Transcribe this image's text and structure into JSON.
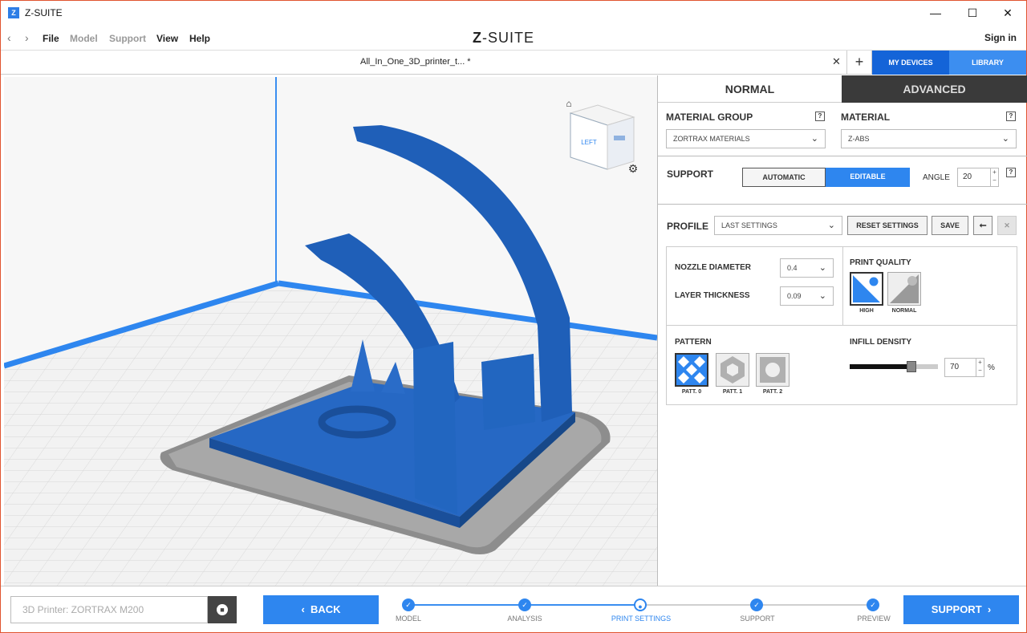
{
  "window": {
    "title": "Z-SUITE",
    "icon_letter": "Z",
    "minimize": "—",
    "maximize": "☐",
    "close": "✕"
  },
  "menu": {
    "back": "‹",
    "forward": "›",
    "items": [
      "File",
      "Model",
      "Support",
      "View",
      "Help"
    ],
    "logo_mark": "Z",
    "logo_text": "-SUITE",
    "signin": "Sign in"
  },
  "tabs": {
    "document": "All_In_One_3D_printer_t... *",
    "close": "✕",
    "add": "+",
    "devices": "MY DEVICES",
    "library": "LIBRARY"
  },
  "viewcube": {
    "face": "LEFT",
    "home_icon": "home-icon",
    "settings_icon": "gear-icon"
  },
  "panel": {
    "mode_normal": "NORMAL",
    "mode_advanced": "ADVANCED",
    "material_group_label": "MATERIAL GROUP",
    "material_group_value": "ZORTRAX MATERIALS",
    "material_label": "MATERIAL",
    "material_value": "Z-ABS",
    "help": "?",
    "support_label": "SUPPORT",
    "support_automatic": "AUTOMATIC",
    "support_editable": "EDITABLE",
    "angle_label": "ANGLE",
    "angle_value": "20",
    "profile_label": "PROFILE",
    "profile_value": "LAST SETTINGS",
    "reset_label": "RESET SETTINGS",
    "save_label": "SAVE",
    "nozzle_label": "NOZZLE DIAMETER",
    "nozzle_value": "0.4",
    "layer_label": "LAYER THICKNESS",
    "layer_value": "0.09",
    "quality_label": "PRINT QUALITY",
    "quality_high": "HIGH",
    "quality_normal": "NORMAL",
    "pattern_label": "PATTERN",
    "patterns": [
      "PATT. 0",
      "PATT. 1",
      "PATT. 2"
    ],
    "infill_label": "INFILL DENSITY",
    "infill_value": "70",
    "infill_unit": "%",
    "infill_fraction": 0.7
  },
  "bottom": {
    "printer_placeholder": "3D Printer: ZORTRAX M200",
    "back": "BACK",
    "next": "SUPPORT",
    "steps": [
      "MODEL",
      "ANALYSIS",
      "PRINT SETTINGS",
      "SUPPORT",
      "PREVIEW"
    ],
    "active_step": 2
  },
  "colors": {
    "accent": "#2e86ef",
    "model": "#1f5fb8",
    "raft": "#8a8a8a"
  }
}
